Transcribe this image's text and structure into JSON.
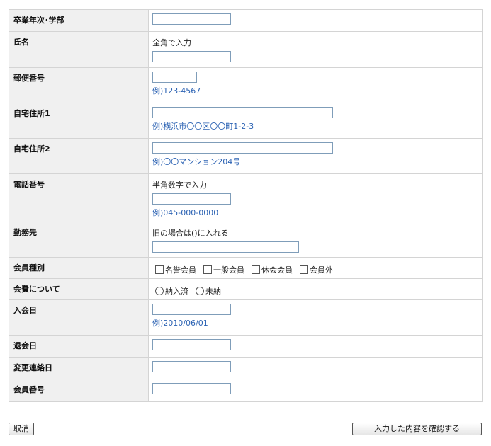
{
  "form": {
    "rows": [
      {
        "label": "卒業年次･学部"
      },
      {
        "label": "氏名",
        "note": "全角で入力"
      },
      {
        "label": "郵便番号",
        "example": "例)123-4567"
      },
      {
        "label": "自宅住所1",
        "example": "例)横浜市〇〇区〇〇町1-2-3"
      },
      {
        "label": "自宅住所2",
        "example": "例)〇〇マンション204号"
      },
      {
        "label": "電話番号",
        "note": "半角数字で入力",
        "example": "例)045-000-0000"
      },
      {
        "label": "勤務先",
        "note": "旧の場合は()に入れる"
      },
      {
        "label": "会員種別",
        "options": [
          "名誉会員",
          "一般会員",
          "休会会員",
          "会員外"
        ]
      },
      {
        "label": "会費について",
        "options": [
          "納入済",
          "未納"
        ]
      },
      {
        "label": "入会日",
        "example": "例)2010/06/01"
      },
      {
        "label": "退会日"
      },
      {
        "label": "変更連絡日"
      },
      {
        "label": "会員番号"
      }
    ]
  },
  "buttons": {
    "cancel": "取消",
    "confirm": "入力した内容を確認する"
  }
}
